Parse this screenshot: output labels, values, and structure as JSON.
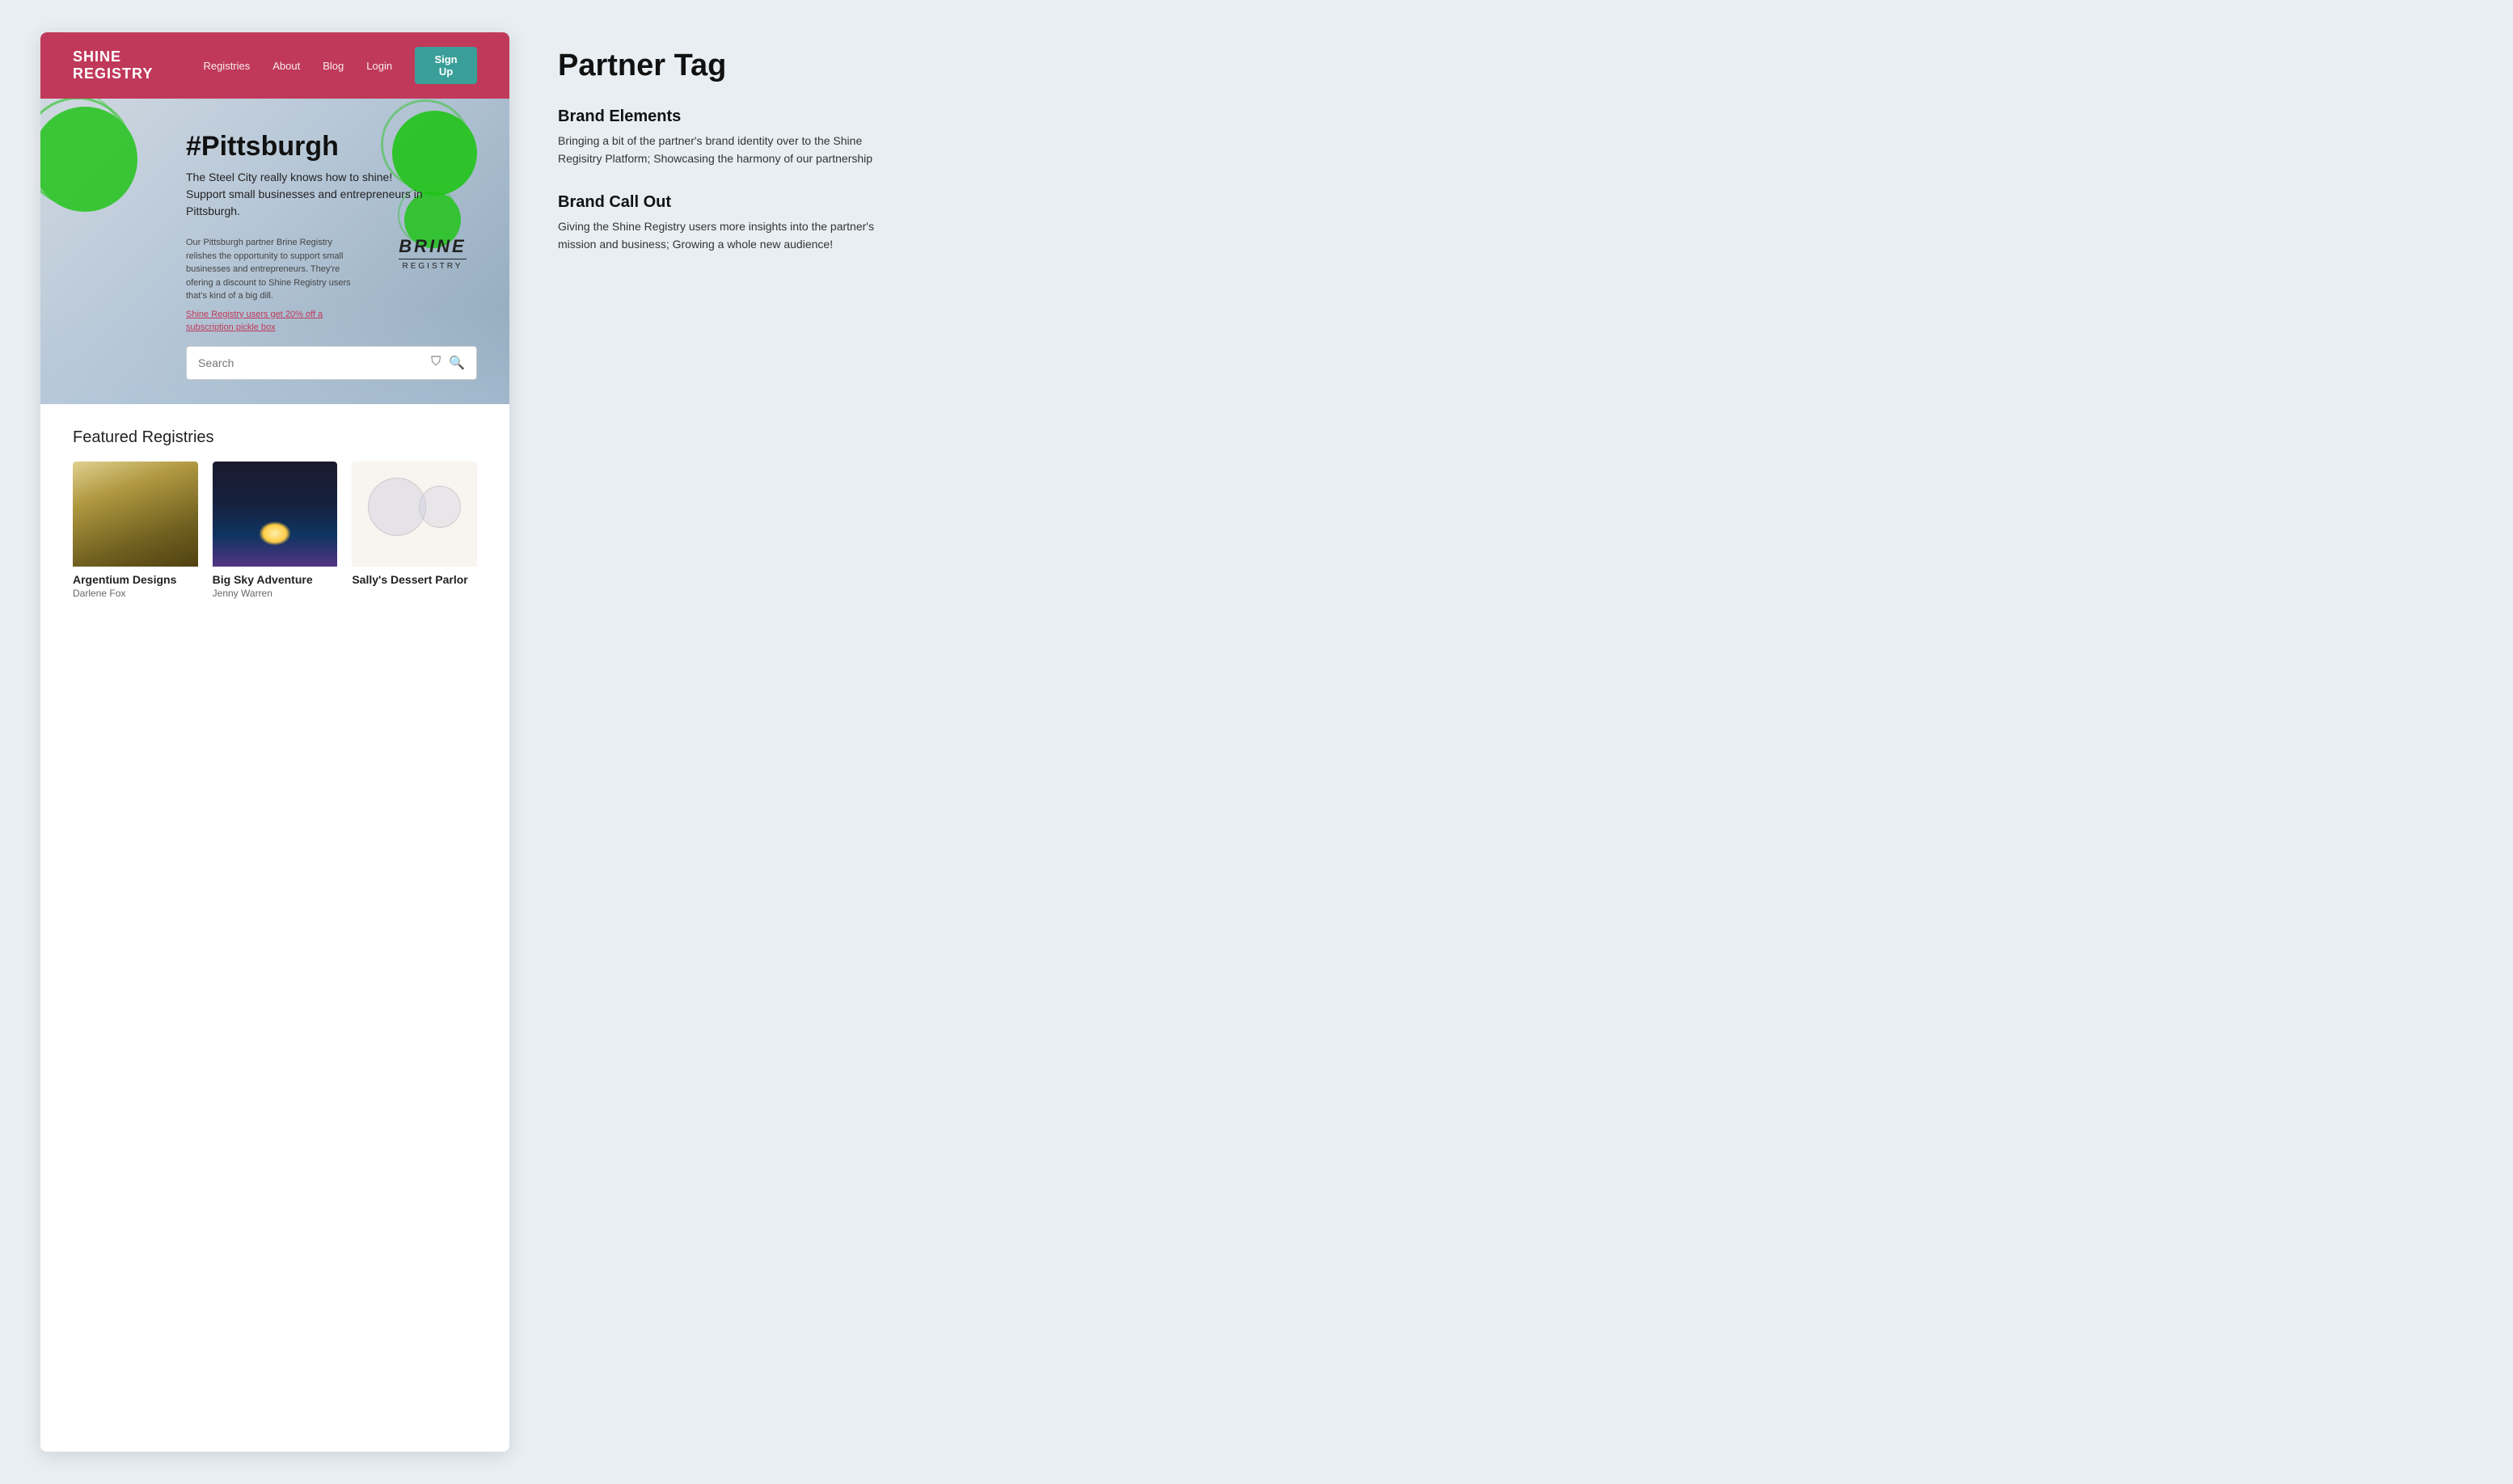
{
  "site": {
    "logo": "SHINE REGISTRY",
    "nav": {
      "registries": "Registries",
      "about": "About",
      "blog": "Blog",
      "login": "Login",
      "signup": "Sign Up"
    }
  },
  "hero": {
    "title": "#Pittsburgh",
    "subtitle_line1": "The Steel City really knows how to shine!",
    "subtitle_line2": "Support small businesses and entrepreneurs in Pittsburgh.",
    "partner_desc": "Our Pittsburgh partner Brine Registry relishes the opportunity to support small businesses and entrepreneurs. They're ofering a discount to Shine Registry users that's kind of a big dill.",
    "promo_text": "Shine Registry users get 20% off a subscription pickle box",
    "partner_logo_main": "BRINE",
    "partner_logo_sub": "REGISTRY",
    "search_placeholder": "Search"
  },
  "featured": {
    "title": "Featured Registries",
    "cards": [
      {
        "name": "Argentium Designs",
        "author": "Darlene Fox"
      },
      {
        "name": "Big Sky Adventure",
        "author": "Jenny Warren"
      },
      {
        "name": "Sally's Dessert Parlor",
        "author": ""
      }
    ]
  },
  "annotations": {
    "main_title": "Partner Tag",
    "items": [
      {
        "title": "Brand Elements",
        "desc": "Bringing a bit of the partner's brand identity over to the Shine Regisitry Platform; Showcasing the harmony of our partnership"
      },
      {
        "title": "Brand Call Out",
        "desc": "Giving the Shine Registry users more insights into the partner's mission and business; Growing a whole new audience!"
      }
    ]
  }
}
